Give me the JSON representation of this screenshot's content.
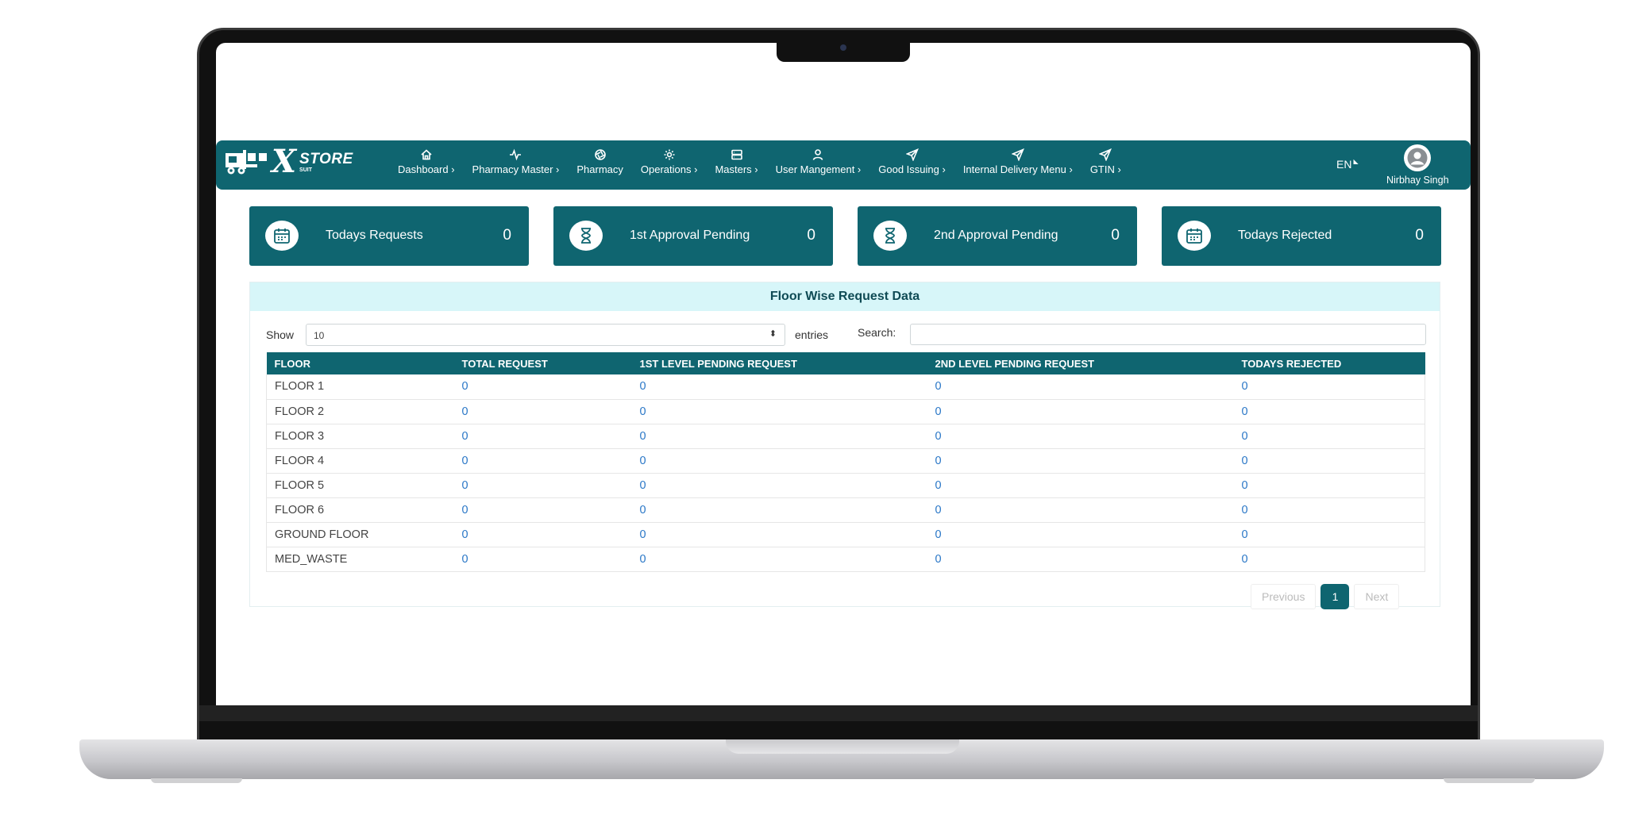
{
  "brand": {
    "letter": "X",
    "store": "STORE",
    "suit": "SUIT"
  },
  "nav": {
    "items": [
      {
        "label": "Dashboard ›",
        "icon": "home-icon"
      },
      {
        "label": "Pharmacy Master ›",
        "icon": "activity-icon"
      },
      {
        "label": "Pharmacy",
        "icon": "aperture-icon"
      },
      {
        "label": "Operations ›",
        "icon": "settings-icon"
      },
      {
        "label": "Masters ›",
        "icon": "server-icon"
      },
      {
        "label": "User Mangement ›",
        "icon": "user-icon"
      },
      {
        "label": "Good Issuing ›",
        "icon": "send-icon"
      },
      {
        "label": "Internal Delivery Menu ›",
        "icon": "send-icon"
      },
      {
        "label": "GTIN ›",
        "icon": "send-icon"
      }
    ],
    "lang": "EN",
    "user_name": "Nirbhay Singh"
  },
  "cards": [
    {
      "label": "Todays Requests",
      "value": "0",
      "icon": "calendar-icon"
    },
    {
      "label": "1st Approval Pending",
      "value": "0",
      "icon": "hourglass-icon"
    },
    {
      "label": "2nd Approval Pending",
      "value": "0",
      "icon": "hourglass-icon"
    },
    {
      "label": "Todays Rejected",
      "value": "0",
      "icon": "calendar-icon"
    }
  ],
  "panel": {
    "title": "Floor Wise Request Data",
    "show_label": "Show",
    "page_size": "10",
    "entries_label": "entries",
    "search_label": "Search:",
    "search_value": ""
  },
  "table": {
    "columns": [
      "FLOOR",
      "TOTAL REQUEST",
      "1ST LEVEL PENDING REQUEST",
      "2ND LEVEL PENDING REQUEST",
      "TODAYS REJECTED"
    ],
    "rows": [
      [
        "FLOOR 1",
        "0",
        "0",
        "0",
        "0"
      ],
      [
        "FLOOR 2",
        "0",
        "0",
        "0",
        "0"
      ],
      [
        "FLOOR 3",
        "0",
        "0",
        "0",
        "0"
      ],
      [
        "FLOOR 4",
        "0",
        "0",
        "0",
        "0"
      ],
      [
        "FLOOR 5",
        "0",
        "0",
        "0",
        "0"
      ],
      [
        "FLOOR 6",
        "0",
        "0",
        "0",
        "0"
      ],
      [
        "GROUND FLOOR",
        "0",
        "0",
        "0",
        "0"
      ],
      [
        "MED_WASTE",
        "0",
        "0",
        "0",
        "0"
      ]
    ]
  },
  "pagination": {
    "previous": "Previous",
    "current": "1",
    "next": "Next"
  },
  "colors": {
    "primary": "#0f6570",
    "header_tint": "#d7f6f9",
    "link": "#2a77c7"
  }
}
